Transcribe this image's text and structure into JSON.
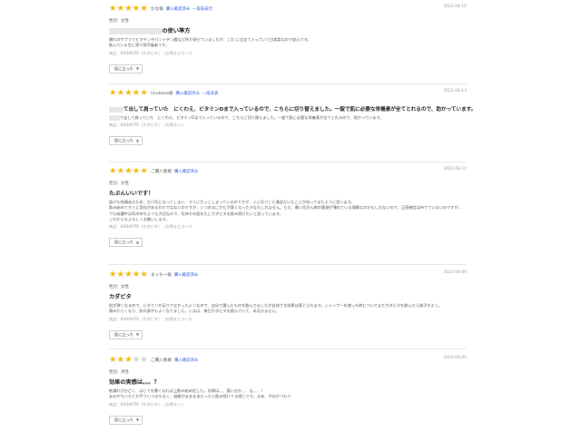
{
  "colors": {
    "star": "#f5b50a",
    "star_off": "#cfcfcf",
    "link": "#2b5bd7"
  },
  "reviews": [
    {
      "reviewer": "かな様",
      "links": [
        "購入確認済み",
        "一般非表示"
      ],
      "date": "2022-08-16",
      "rating": 5,
      "gender": "性別：女性",
      "title_prefix": "",
      "title": "の使い準方",
      "body": [
        "爆れのサプリでビオチンやパントテン酸など所り寄せていましたが、これ に比全て入っていて日本製なので安心です。",
        "飲んでいる生に男で理予審者です。"
      ],
      "product": "商品：KADAVITA（カダビタ）｜お得まとコース",
      "button": "役に立った"
    },
    {
      "reviewer": "hirokane様",
      "links": [
        "購入確認済み",
        "一般非表"
      ],
      "date": "2022-08-13",
      "rating": 5,
      "gender": "性別：女性",
      "title_prefix": "",
      "title": "て出して肩っていた　にくわえ、ビタミンDまで入っているので、こちらに切り替えました。一錠で肌に必要な栄養素が全てとれるので、助かっています。",
      "body": [
        "で出して肩っていた　にくわえ、ビタミンDまで入っているので、こちらに切り替えました。一錠で肌に必要な栄養素が全てとれるので、助かっています。"
      ],
      "product": "商品：KADAVITA（カダビタ）｜お得セット",
      "button": "役に立った"
    },
    {
      "reviewer": "ご購入者様",
      "links": [
        "購入確認済み"
      ],
      "date": "2022-08-11",
      "rating": 5,
      "gender": "性別：女性",
      "title_prefix": "",
      "title": "たぷんいいです！",
      "body": [
        "抜けも結構あるため、だけ気になってしまい、すぐに引っこしまっているのですが、ふと気づくと違送だいたことが成ってまたように思います。",
        "飲み始めてすぐに変化があるわけではないのですが、いつのまにかだが落くなったかなもしれません。ただ、最い気がん剤の薬避が薄れている理解なのかもしれないので、正直確信は持てていないのですが…",
        "でも岐優中は気の持ちようも大切なので、気持ちの面をたにカダビタを飲み続けたいと思っています。",
        "これからもよろしくお願いします。"
      ],
      "product": "商品：KADAVITA（カダビタ）｜お得まとコース",
      "button": "役に立った"
    },
    {
      "reviewer": "まっちー様",
      "links": [
        "購入確認済み"
      ],
      "date": "2022-08-09",
      "rating": 5,
      "gender": "性別：女性",
      "title_prefix": "",
      "title": "カダビタ",
      "body": [
        "肌が弾くなるので、ビタミンが足りてなかったようなので、自分で選んだものを飲んでましたが自体ざる効果は感じられます。シャンプーを使った時についてまたカダビタを飲んだら調子がよく。",
        "頬みからくなり、肌の調子もよくなりました。いまは、毎日カダビタを飲んでいて、半月分ません。"
      ],
      "product": "商品：KADAVITA（カダビタ）｜お得まとコース",
      "button": "役に立った"
    },
    {
      "reviewer": "ご購入者様",
      "links": [
        "購入確認済み"
      ],
      "date": "2022-08-05",
      "rating": 3,
      "gender": "性別：男性",
      "title_prefix": "",
      "title": "効果の実感は。。。？",
      "body": [
        "乾燥れがひどく、はじでを暴くなれば上飲み始め定した。効果は、、、薬い分か、、、な、、、！",
        "あみがちいたとか不ういうのもなく、価格がまあまあだったら飲み続けてる感じです。まあ、予向かつもり"
      ],
      "product": "商品：KADAVITA（カダビタ）｜お得セット",
      "button": "役に立った"
    }
  ]
}
